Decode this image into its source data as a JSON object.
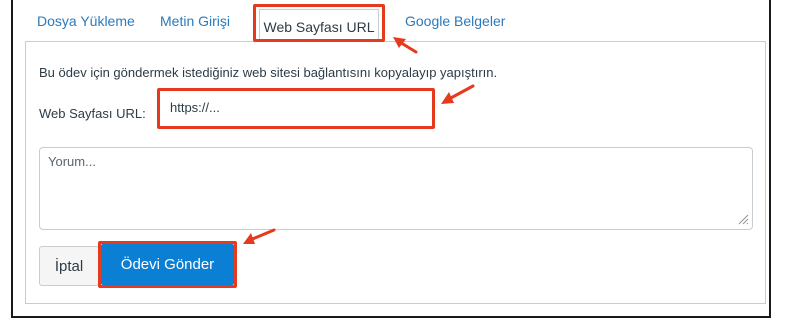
{
  "tabs": [
    {
      "label": "Dosya Yükleme",
      "active": false
    },
    {
      "label": "Metin Girişi",
      "active": false
    },
    {
      "label": "Web Sayfası URL",
      "active": true
    },
    {
      "label": "Google Belgeler",
      "active": false
    }
  ],
  "panel": {
    "instruction": "Bu ödev için göndermek istediğiniz web sitesi bağlantısını kopyalayıp yapıştırın.",
    "url_label": "Web Sayfası URL:",
    "url_value": "https://...",
    "comment_placeholder": "Yorum..."
  },
  "buttons": {
    "cancel_label": "İptal",
    "submit_label": "Ödevi Gönder"
  },
  "colors": {
    "highlight": "#e53a1e",
    "tab_link": "#2b7abc",
    "primary_button": "#0a7fd4"
  },
  "icons": {
    "resize": "resize-handle-icon",
    "annotation_arrow": "arrow-icon"
  }
}
